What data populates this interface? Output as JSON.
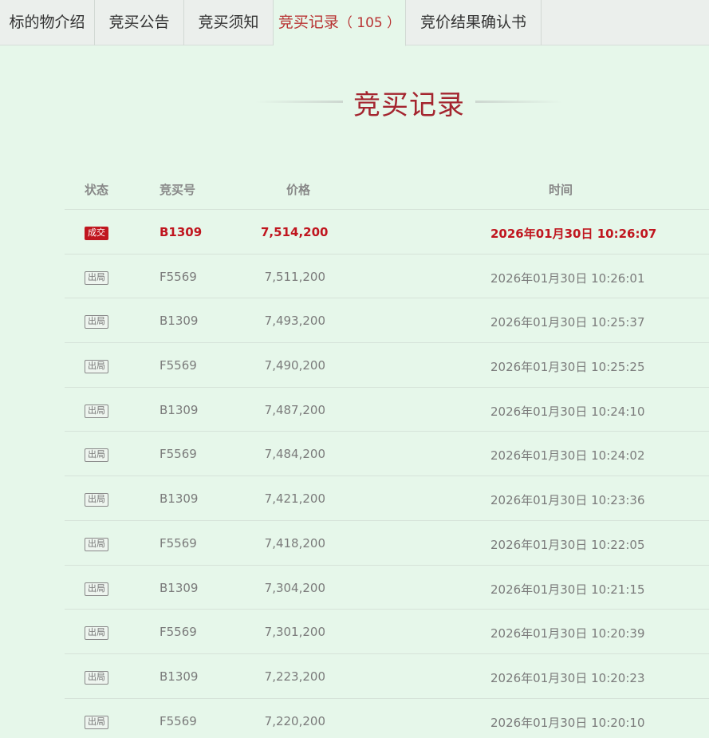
{
  "tabs": [
    {
      "label": "标的物介绍"
    },
    {
      "label": "竞买公告"
    },
    {
      "label": "竞买须知"
    },
    {
      "label": "竞买记录",
      "count": "（ 105 ）"
    },
    {
      "label": "竞价结果确认书"
    }
  ],
  "section_title": "竞买记录",
  "columns": {
    "status": "状态",
    "bid_number": "竞买号",
    "price": "价格",
    "time": "时间"
  },
  "records": [
    {
      "status": "成交",
      "bidder": "B1309",
      "price": "7,514,200",
      "time": "2026年01月30日 10:26:07"
    },
    {
      "status": "出局",
      "bidder": "F5569",
      "price": "7,511,200",
      "time": "2026年01月30日 10:26:01"
    },
    {
      "status": "出局",
      "bidder": "B1309",
      "price": "7,493,200",
      "time": "2026年01月30日 10:25:37"
    },
    {
      "status": "出局",
      "bidder": "F5569",
      "price": "7,490,200",
      "time": "2026年01月30日 10:25:25"
    },
    {
      "status": "出局",
      "bidder": "B1309",
      "price": "7,487,200",
      "time": "2026年01月30日 10:24:10"
    },
    {
      "status": "出局",
      "bidder": "F5569",
      "price": "7,484,200",
      "time": "2026年01月30日 10:24:02"
    },
    {
      "status": "出局",
      "bidder": "B1309",
      "price": "7,421,200",
      "time": "2026年01月30日 10:23:36"
    },
    {
      "status": "出局",
      "bidder": "F5569",
      "price": "7,418,200",
      "time": "2026年01月30日 10:22:05"
    },
    {
      "status": "出局",
      "bidder": "B1309",
      "price": "7,304,200",
      "time": "2026年01月30日 10:21:15"
    },
    {
      "status": "出局",
      "bidder": "F5569",
      "price": "7,301,200",
      "time": "2026年01月30日 10:20:39"
    },
    {
      "status": "出局",
      "bidder": "B1309",
      "price": "7,223,200",
      "time": "2026年01月30日 10:20:23"
    },
    {
      "status": "出局",
      "bidder": "F5569",
      "price": "7,220,200",
      "time": "2026年01月30日 10:20:10"
    }
  ],
  "colors": {
    "accent": "#b83232",
    "deal_red": "#c0161f",
    "background": "#e6f7ea"
  }
}
